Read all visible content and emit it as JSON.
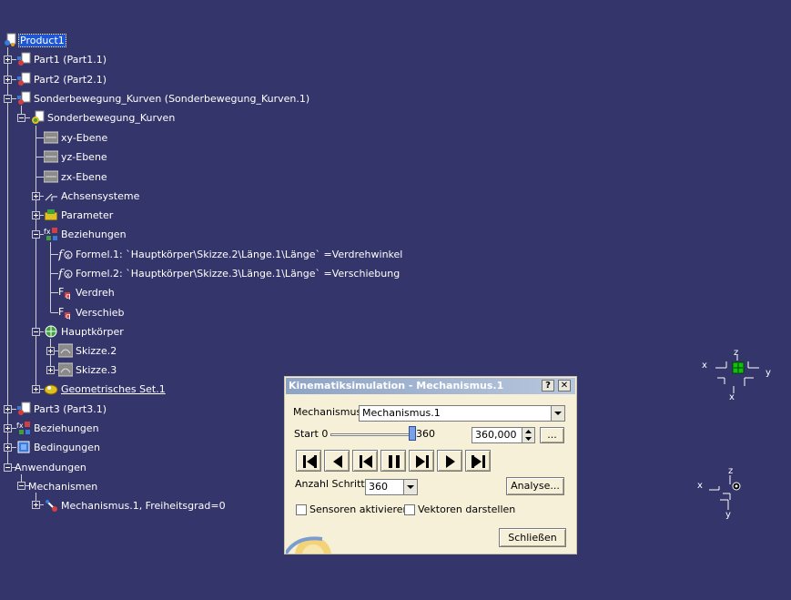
{
  "colors": {
    "background": "#34356a",
    "dialog_bg": "#f6f0d8",
    "selection": "#1e57d6",
    "titlebar": "#8ea4c6"
  },
  "tree": {
    "root": "Product1",
    "part1": "Part1 (Part1.1)",
    "part2": "Part2 (Part2.1)",
    "sonder": "Sonderbewegung_Kurven (Sonderbewegung_Kurven.1)",
    "sonder_part": "Sonderbewegung_Kurven",
    "xy": "xy-Ebene",
    "yz": "yz-Ebene",
    "zx": "zx-Ebene",
    "achsensysteme": "Achsensysteme",
    "parameter": "Parameter",
    "beziehungen_inner": "Beziehungen",
    "formel1": "Formel.1: `Hauptkörper\\Skizze.2\\Länge.1\\Länge` =Verdrehwinkel",
    "formel2": "Formel.2: `Hauptkörper\\Skizze.3\\Länge.1\\Länge` =Verschiebung",
    "verdreh": "Verdreh",
    "verschieb": "Verschieb",
    "hauptkoerper": "Hauptkörper",
    "skizze2": "Skizze.2",
    "skizze3": "Skizze.3",
    "geoset": "Geometrisches Set.1",
    "part3": "Part3 (Part3.1)",
    "beziehungen": "Beziehungen",
    "bedingungen": "Bedingungen",
    "anwendungen": "Anwendungen",
    "mechanismen": "Mechanismen",
    "mechanismus1": "Mechanismus.1, Freiheitsgrad=0"
  },
  "dialog": {
    "title": "Kinematiksimulation - Mechanismus.1",
    "help_label": "?",
    "close_label": "✕",
    "mechanismus_label": "Mechanismus:",
    "mechanismus_value": "Mechanismus.1",
    "start_label": "Start 0",
    "slider_max_label": "360",
    "slider_fraction": 1.0,
    "value_field": "360,000",
    "more_button": "...",
    "anzahl_label": "Anzahl Schritte:",
    "anzahl_value": "360",
    "analyse_button": "Analyse...",
    "sensoren_label": "Sensoren aktivieren",
    "sensoren_checked": false,
    "vektoren_label": "Vektoren darstellen",
    "vektoren_checked": false,
    "schliessen_button": "Schließen",
    "player_buttons": [
      "jump-to-start",
      "play-backward",
      "step-backward",
      "pause",
      "step-forward",
      "play-forward",
      "jump-to-end"
    ]
  },
  "compass_main": {
    "x": "x",
    "y": "y",
    "z": "z"
  },
  "compass_small": {
    "x": "x",
    "y": "y",
    "z": "z"
  }
}
